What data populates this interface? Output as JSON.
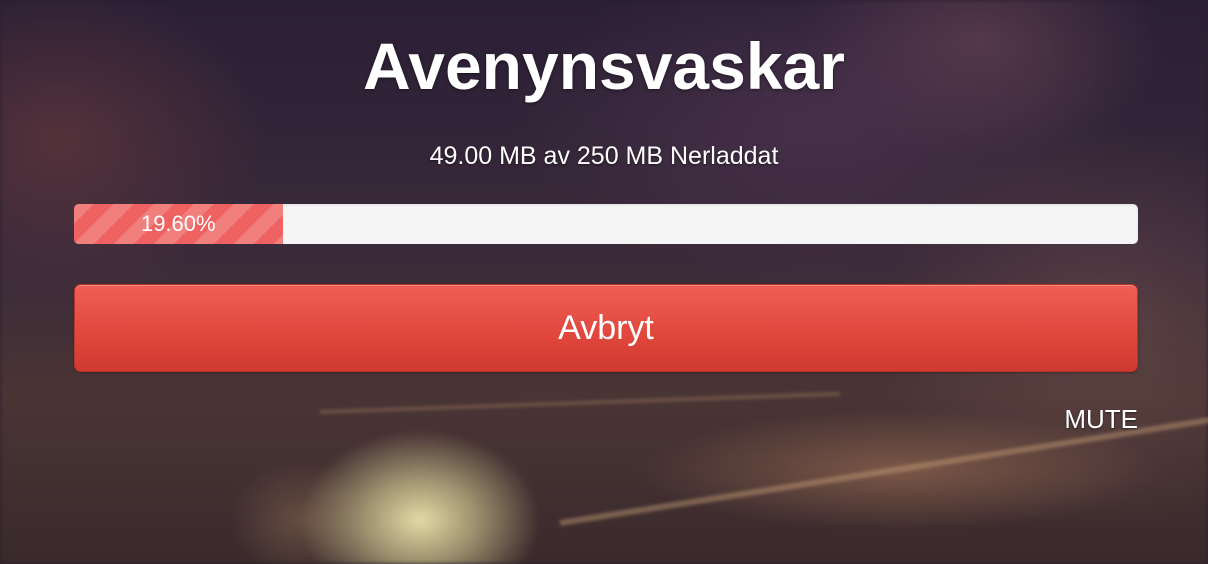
{
  "title": "Avenynsvaskar",
  "download": {
    "status_text": "49.00 MB av 250 MB Nerladdat",
    "progress_fraction": 0.196,
    "progress_label": "19.60%"
  },
  "actions": {
    "cancel_label": "Avbryt",
    "mute_label": "MUTE"
  },
  "colors": {
    "progress_fill": "#ee6361",
    "progress_track": "#f5f5f5",
    "cancel_button": "#e2483e",
    "text": "#ffffff"
  }
}
